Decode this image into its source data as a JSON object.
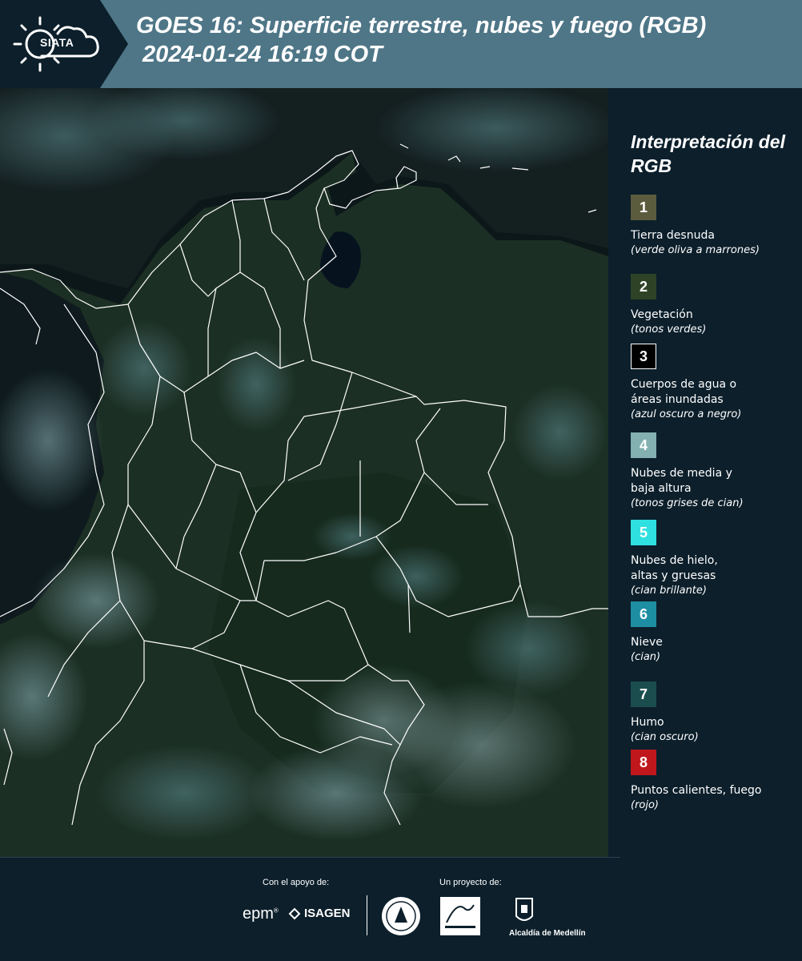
{
  "header": {
    "logo_text": "SIATA",
    "title": "GOES 16: Superficie terrestre, nubes y fuego (RGB)",
    "timestamp": " 2024-01-24 16:19 COT"
  },
  "legend": {
    "title": "Interpretación del RGB",
    "items": [
      {
        "number": "1",
        "label": "Tierra desnuda",
        "sub": "(verde oliva a marrones)",
        "color": "#5b5c3e"
      },
      {
        "number": "2",
        "label": "Vegetación",
        "sub": "(tonos verdes)",
        "color": "#2e4325"
      },
      {
        "number": "3",
        "label": "Cuerpos de agua o áreas inundadas",
        "sub": "(azul oscuro a negro)",
        "color": "#000000"
      },
      {
        "number": "4",
        "label": "Nubes de media y baja altura",
        "sub": "(tonos grises de cian)",
        "color": "#83b0b0"
      },
      {
        "number": "5",
        "label": "Nubes de hielo, altas y gruesas",
        "sub": "(cian brillante)",
        "color": "#2ee0e0"
      },
      {
        "number": "6",
        "label": "Nieve",
        "sub": "(cian)",
        "color": "#1e8ea3"
      },
      {
        "number": "7",
        "label": "Humo",
        "sub": "(cian oscuro)",
        "color": "#1b4d4f"
      },
      {
        "number": "8",
        "label": "Puntos calientes, fuego",
        "sub": "(rojo)",
        "color": "#c0171d"
      }
    ]
  },
  "footer": {
    "support_label": "Con el apoyo de:",
    "project_label": "Un proyecto de:",
    "epm": "epm",
    "isagen": "ISAGEN",
    "alcaldia": "Alcaldía de Medellín"
  },
  "colors": {
    "header_bg": "#4e7687",
    "logo_bg": "#0c1f2b",
    "page_bg": "#0c1f2b",
    "map_land": "#1a2d22",
    "boundary": "#ffffff"
  }
}
